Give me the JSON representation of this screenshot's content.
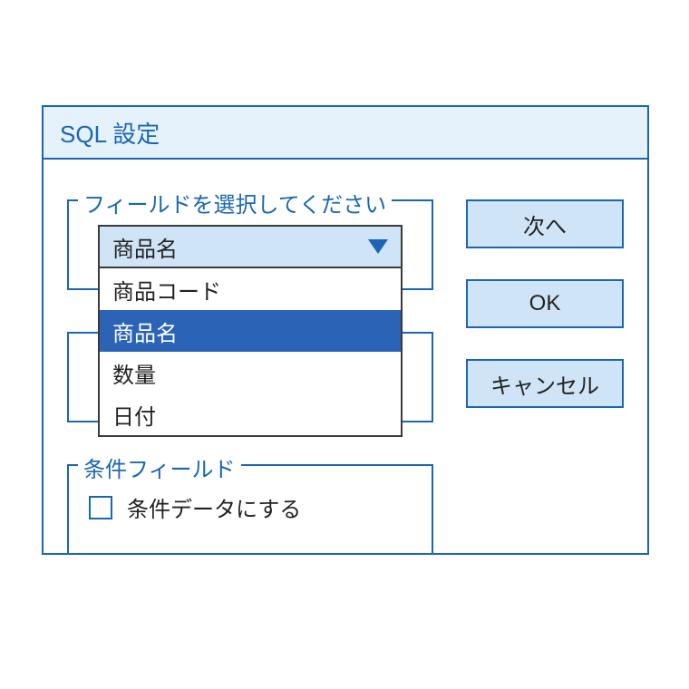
{
  "dialog": {
    "title": "SQL 設定"
  },
  "fieldset1": {
    "legend": "フィールドを選択してください"
  },
  "fieldset2": {
    "legend": ""
  },
  "fieldset3": {
    "legend": "条件フィールド",
    "checkbox_label": "条件データにする"
  },
  "select": {
    "value": "商品名",
    "options": [
      "商品コード",
      "商品名",
      "数量",
      "日付"
    ],
    "selected_index": 1
  },
  "buttons": {
    "next": "次へ",
    "ok": "OK",
    "cancel": "キャンセル"
  },
  "colors": {
    "border": "#1a66b3",
    "title_bg": "#e6f2fb",
    "button_bg": "#cfe4f6",
    "highlight": "#2b64b7"
  }
}
